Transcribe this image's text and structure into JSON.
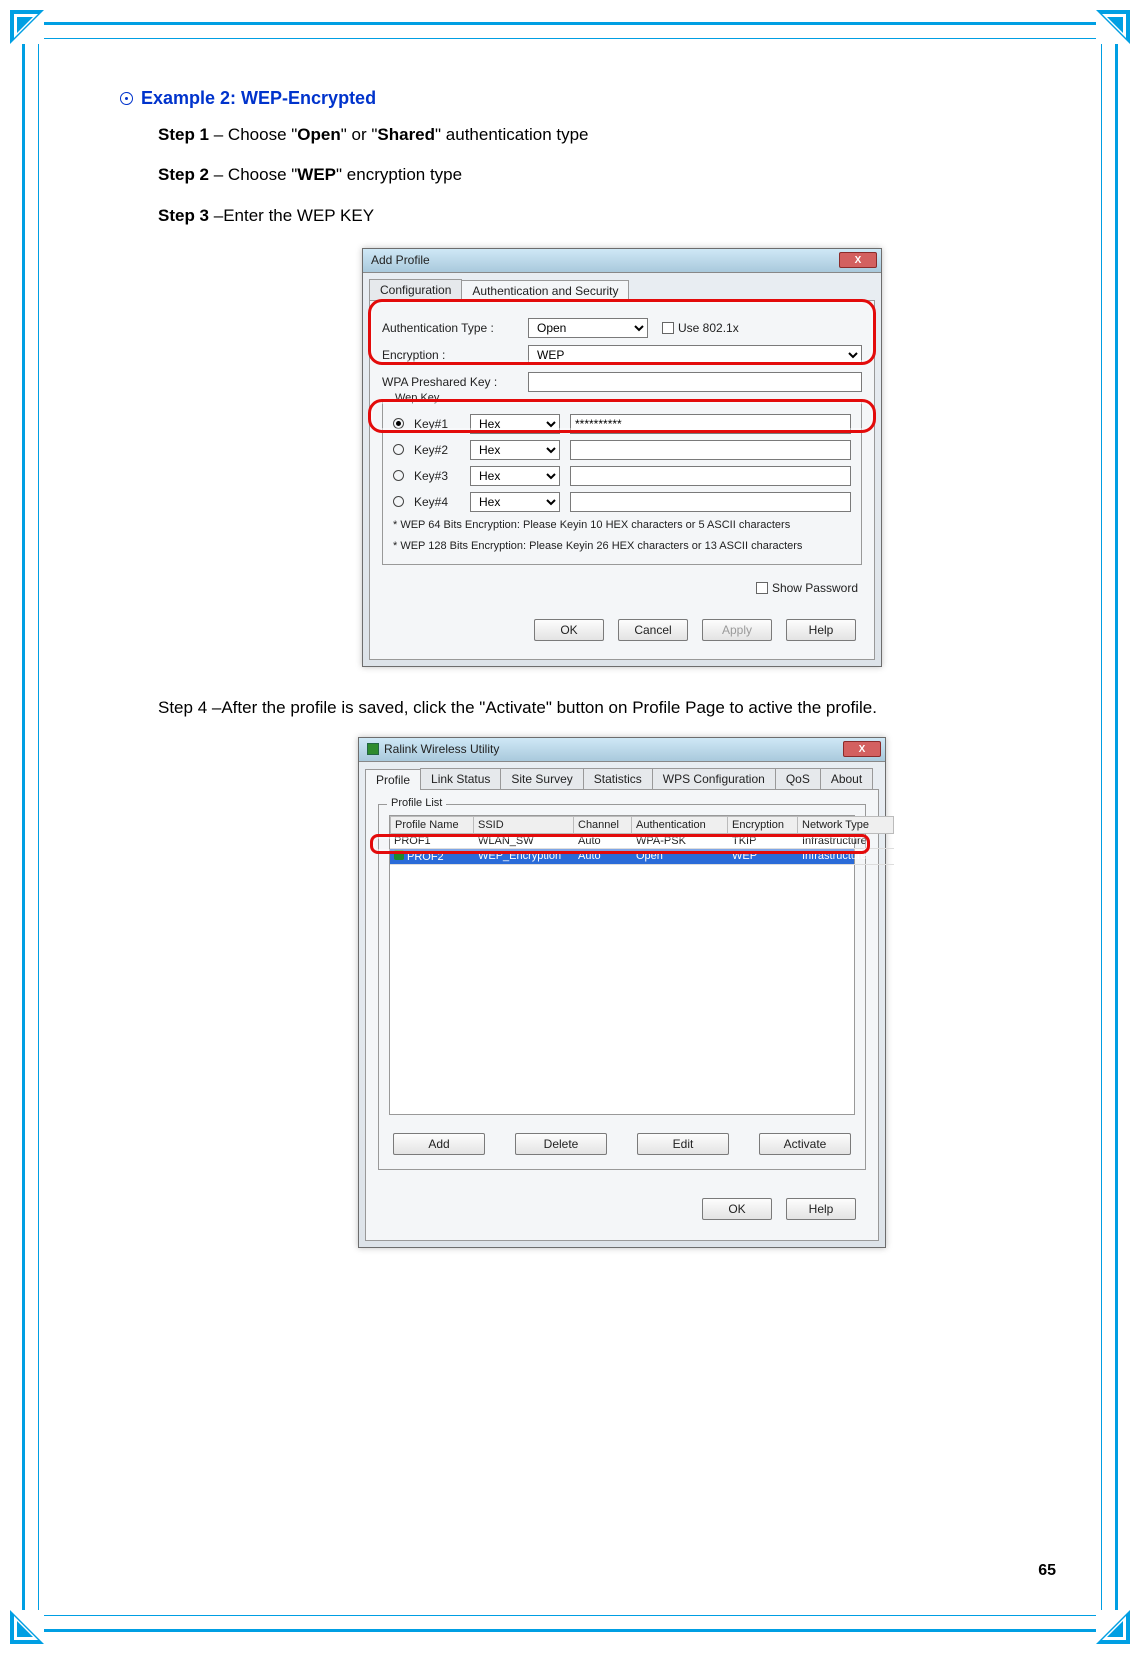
{
  "heading": "Example 2: WEP-Encrypted",
  "steps": {
    "s1_pre": "Step 1",
    "s1_mid": " – Choose \"",
    "s1_b1": "Open",
    "s1_mid2": "\" or \"",
    "s1_b2": "Shared",
    "s1_post": "\" authentication type",
    "s2_pre": "Step 2",
    "s2_mid": " – Choose \"",
    "s2_b1": "WEP",
    "s2_post": "\" encryption type",
    "s3_pre": "Step 3",
    "s3_post": " –Enter the WEP KEY",
    "s4_pre": "Step 4",
    "s4_mid": " –After the profile is saved, click the \"",
    "s4_b1": "Activate",
    "s4_post": "\" button on Profile Page to active the profile."
  },
  "dialog1": {
    "title": "Add Profile",
    "tabs": {
      "t1": "Configuration",
      "t2": "Authentication and Security"
    },
    "auth_label": "Authentication Type :",
    "auth_value": "Open",
    "use8021x": "Use 802.1x",
    "enc_label": "Encryption :",
    "enc_value": "WEP",
    "psk_label": "WPA Preshared Key :",
    "wepkey_legend": "Wep Key",
    "keys": [
      {
        "label": "Key#1",
        "fmt": "Hex",
        "val": "**********",
        "selected": true
      },
      {
        "label": "Key#2",
        "fmt": "Hex",
        "val": "",
        "selected": false
      },
      {
        "label": "Key#3",
        "fmt": "Hex",
        "val": "",
        "selected": false
      },
      {
        "label": "Key#4",
        "fmt": "Hex",
        "val": "",
        "selected": false
      }
    ],
    "hint1": "* WEP 64 Bits Encryption:  Please Keyin 10 HEX characters or 5 ASCII characters",
    "hint2": "* WEP 128 Bits Encryption:  Please Keyin 26 HEX characters or 13 ASCII characters",
    "showpw": "Show Password",
    "ok": "OK",
    "cancel": "Cancel",
    "apply": "Apply",
    "help": "Help"
  },
  "dialog2": {
    "title": "Ralink Wireless Utility",
    "tabs": [
      "Profile",
      "Link Status",
      "Site Survey",
      "Statistics",
      "WPS Configuration",
      "QoS",
      "About"
    ],
    "fieldset": "Profile List",
    "columns": [
      "Profile Name",
      "SSID",
      "Channel",
      "Authentication",
      "Encryption",
      "Network Type"
    ],
    "rows": [
      {
        "name": "PROF1",
        "ssid": "WLAN_SW",
        "ch": "Auto",
        "auth": "WPA-PSK",
        "enc": "TKIP",
        "nt": "Infrastructure",
        "selected": false
      },
      {
        "name": "PROF2",
        "ssid": "WEP_Encryption",
        "ch": "Auto",
        "auth": "Open",
        "enc": "WEP",
        "nt": "Infrastructure",
        "selected": true
      }
    ],
    "add": "Add",
    "delete": "Delete",
    "edit": "Edit",
    "activate": "Activate",
    "ok": "OK",
    "help": "Help"
  },
  "page_number": "65"
}
